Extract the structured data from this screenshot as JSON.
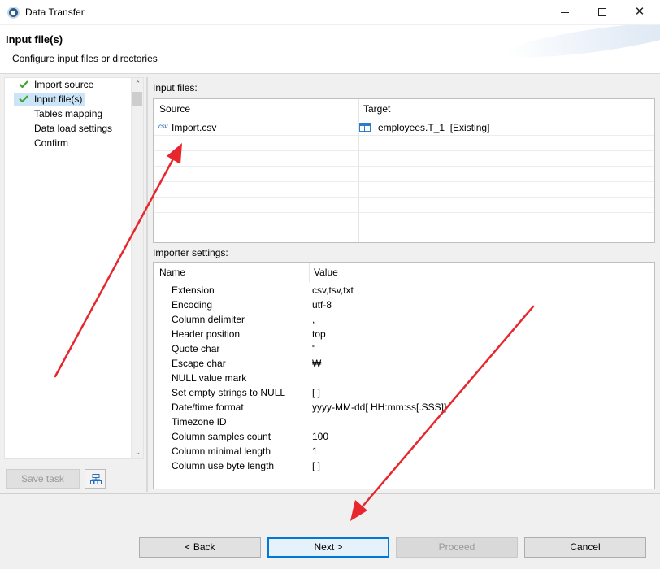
{
  "window": {
    "title": "Data Transfer"
  },
  "header": {
    "title": "Input file(s)",
    "description": "Configure input files or directories"
  },
  "nav": {
    "items": [
      {
        "label": "Import source",
        "done": true,
        "selected": false
      },
      {
        "label": "Input file(s)",
        "done": true,
        "selected": true
      },
      {
        "label": "Tables mapping",
        "done": false,
        "selected": false
      },
      {
        "label": "Data load settings",
        "done": false,
        "selected": false
      },
      {
        "label": "Confirm",
        "done": false,
        "selected": false
      }
    ],
    "save_task_label": "Save task"
  },
  "input_files": {
    "label": "Input files:",
    "columns": [
      "Source",
      "Target"
    ],
    "rows": [
      {
        "source_icon": "csv-file-icon",
        "source": "Import.csv",
        "target_icon": "table-icon",
        "target": "employees.T_1  [Existing]"
      }
    ]
  },
  "importer_settings": {
    "label": "Importer settings:",
    "columns": [
      "Name",
      "Value"
    ],
    "rows": [
      {
        "name": "Extension",
        "value": "csv,tsv,txt"
      },
      {
        "name": "Encoding",
        "value": "utf-8"
      },
      {
        "name": "Column delimiter",
        "value": ","
      },
      {
        "name": "Header position",
        "value": "top"
      },
      {
        "name": "Quote char",
        "value": "\""
      },
      {
        "name": "Escape char",
        "value": "₩"
      },
      {
        "name": "NULL value mark",
        "value": ""
      },
      {
        "name": "Set empty strings to NULL",
        "value": "[ ]"
      },
      {
        "name": "Date/time format",
        "value": "yyyy-MM-dd[ HH:mm:ss[.SSS]]"
      },
      {
        "name": "Timezone ID",
        "value": ""
      },
      {
        "name": "Column samples count",
        "value": "100"
      },
      {
        "name": "Column minimal length",
        "value": "1"
      },
      {
        "name": "Column use byte length",
        "value": "[ ]"
      }
    ]
  },
  "buttons": {
    "back": "< Back",
    "next": "Next >",
    "proceed": "Proceed",
    "cancel": "Cancel"
  },
  "colors": {
    "accent": "#0078d7",
    "selection": "#cce4f7",
    "check": "#3fa535",
    "annotation_arrow": "#e8262d"
  }
}
